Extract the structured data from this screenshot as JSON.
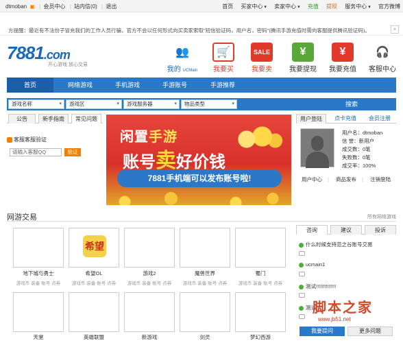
{
  "topbar": {
    "username": "dtmoban",
    "member_center": "会员中心",
    "messages": "站内信(0)",
    "logout": "退出",
    "home": "首页",
    "buyer_center": "买家中心",
    "seller_center": "卖家中心",
    "recharge": "充值",
    "withdraw": "提现",
    "service_center": "服务中心",
    "official_weibo": "官方微博"
  },
  "notice": {
    "text": "方提醒：最近有不法份子冒充我们的工作人员行骗，官方不会以任何形式向买卖家索取\"短信验证码，用户名，密码\"(腾讯手游充值时需向客服提供腾讯验证码)。",
    "close": "×"
  },
  "header": {
    "brand_main": "7881",
    "brand_suffix": ".com",
    "slogan": "开心游戏 放心交易",
    "nav": [
      {
        "label": "我的",
        "sub": "UCMain",
        "icon": "people-icon"
      },
      {
        "label": "我要买",
        "icon": "cart-icon"
      },
      {
        "label": "我要卖",
        "icon": "sale-icon"
      },
      {
        "label": "我要提现",
        "icon": "cash-icon"
      },
      {
        "label": "我要充值",
        "icon": "recharge-icon"
      },
      {
        "label": "客服中心",
        "icon": "service-icon"
      }
    ]
  },
  "mainnav": [
    "首页",
    "网络游戏",
    "手机游戏",
    "手游账号",
    "手游推荐"
  ],
  "search": {
    "selects": [
      "游戏名称",
      "游戏区",
      "游戏服务器",
      "物品类型"
    ],
    "button": "搜索"
  },
  "lefttabs": [
    "公告",
    "新手指南",
    "常见问题"
  ],
  "verify": {
    "title": "客服客服验证",
    "placeholder": "请输入客服QQ",
    "button": "验证"
  },
  "banner": {
    "line1a": "闲置",
    "line1b": "手游",
    "line2a": "账号",
    "line2b": "卖",
    "line2c": "好价钱",
    "pill": "7881手机端可以发布账号啦!"
  },
  "righttabs": [
    "用户登陆",
    "点卡充值",
    "会员注册"
  ],
  "user": {
    "username": "用户名：dtmoban",
    "credit": "信    誉：新用户",
    "deals": "成交数：0笔",
    "failed": "失败数：0笔",
    "rate": "成交率：100%",
    "links": [
      "用户中心",
      "商品发布",
      "注销登陆"
    ]
  },
  "section": {
    "title": "网游交易",
    "all": "所有网络游戏"
  },
  "games": [
    {
      "name": "地下城与勇士",
      "links": [
        "游戏币",
        "装备",
        "账号",
        "点券"
      ]
    },
    {
      "name": "希望OL",
      "links": [
        "游戏币",
        "装备",
        "账号",
        "点券"
      ],
      "logo": "希望"
    },
    {
      "name": "游戏2",
      "links": [
        "游戏币",
        "装备",
        "账号",
        "点券"
      ]
    },
    {
      "name": "魔兽世界",
      "links": [
        "游戏币",
        "装备",
        "账号",
        "点券"
      ]
    },
    {
      "name": "蜀门",
      "links": [
        "游戏币",
        "装备",
        "账号",
        "点券"
      ]
    }
  ],
  "games_row2": [
    "天堂",
    "英雄联盟",
    "新游戏",
    "剑灵",
    "梦幻西游"
  ],
  "feedback": {
    "tabs": [
      "咨询",
      "建议",
      "投诉"
    ],
    "items": [
      "什么时候支持范之谷账号交易",
      "ucmain1",
      "测试!!!!!!!!!!!!!!",
      "测试"
    ],
    "btn_ask": "我要提问",
    "btn_more": "更多问题"
  },
  "watermark": {
    "title": "脚本之家",
    "url": "www.jb51.net"
  }
}
